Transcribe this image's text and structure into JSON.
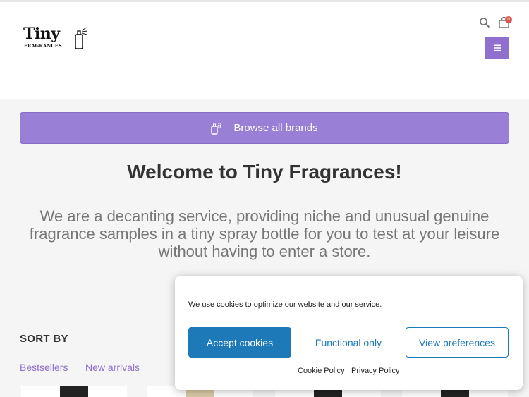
{
  "brand": {
    "name": "Tiny",
    "sub": "FRAGRANCES"
  },
  "header": {
    "cart_count": "0",
    "icons": {
      "search": "search-icon",
      "cart": "shopping-bag-icon",
      "menu": "hamburger-menu-icon"
    }
  },
  "browse": {
    "label": "Browse all brands",
    "icon": "spray-icon"
  },
  "welcome": {
    "title": "Welcome to Tiny Fragrances!",
    "intro": "We are a decanting service, providing niche and unusual genuine fragrance samples in a tiny spray bottle for you to test at your leisure without having to enter a store."
  },
  "sort": {
    "title": "SORT BY",
    "options": [
      "Bestsellers",
      "New arrivals"
    ]
  },
  "cookie": {
    "message": "We use cookies to optimize our website and our service.",
    "accept": "Accept cookies",
    "functional": "Functional only",
    "preferences": "View preferences",
    "cookie_policy": "Cookie Policy",
    "privacy_policy": "Privacy Policy"
  },
  "colors": {
    "accent": "#8f70cf",
    "browse_bg": "#9a7fd6",
    "cookie_blue": "#1e79b9",
    "badge": "#e0574a"
  }
}
